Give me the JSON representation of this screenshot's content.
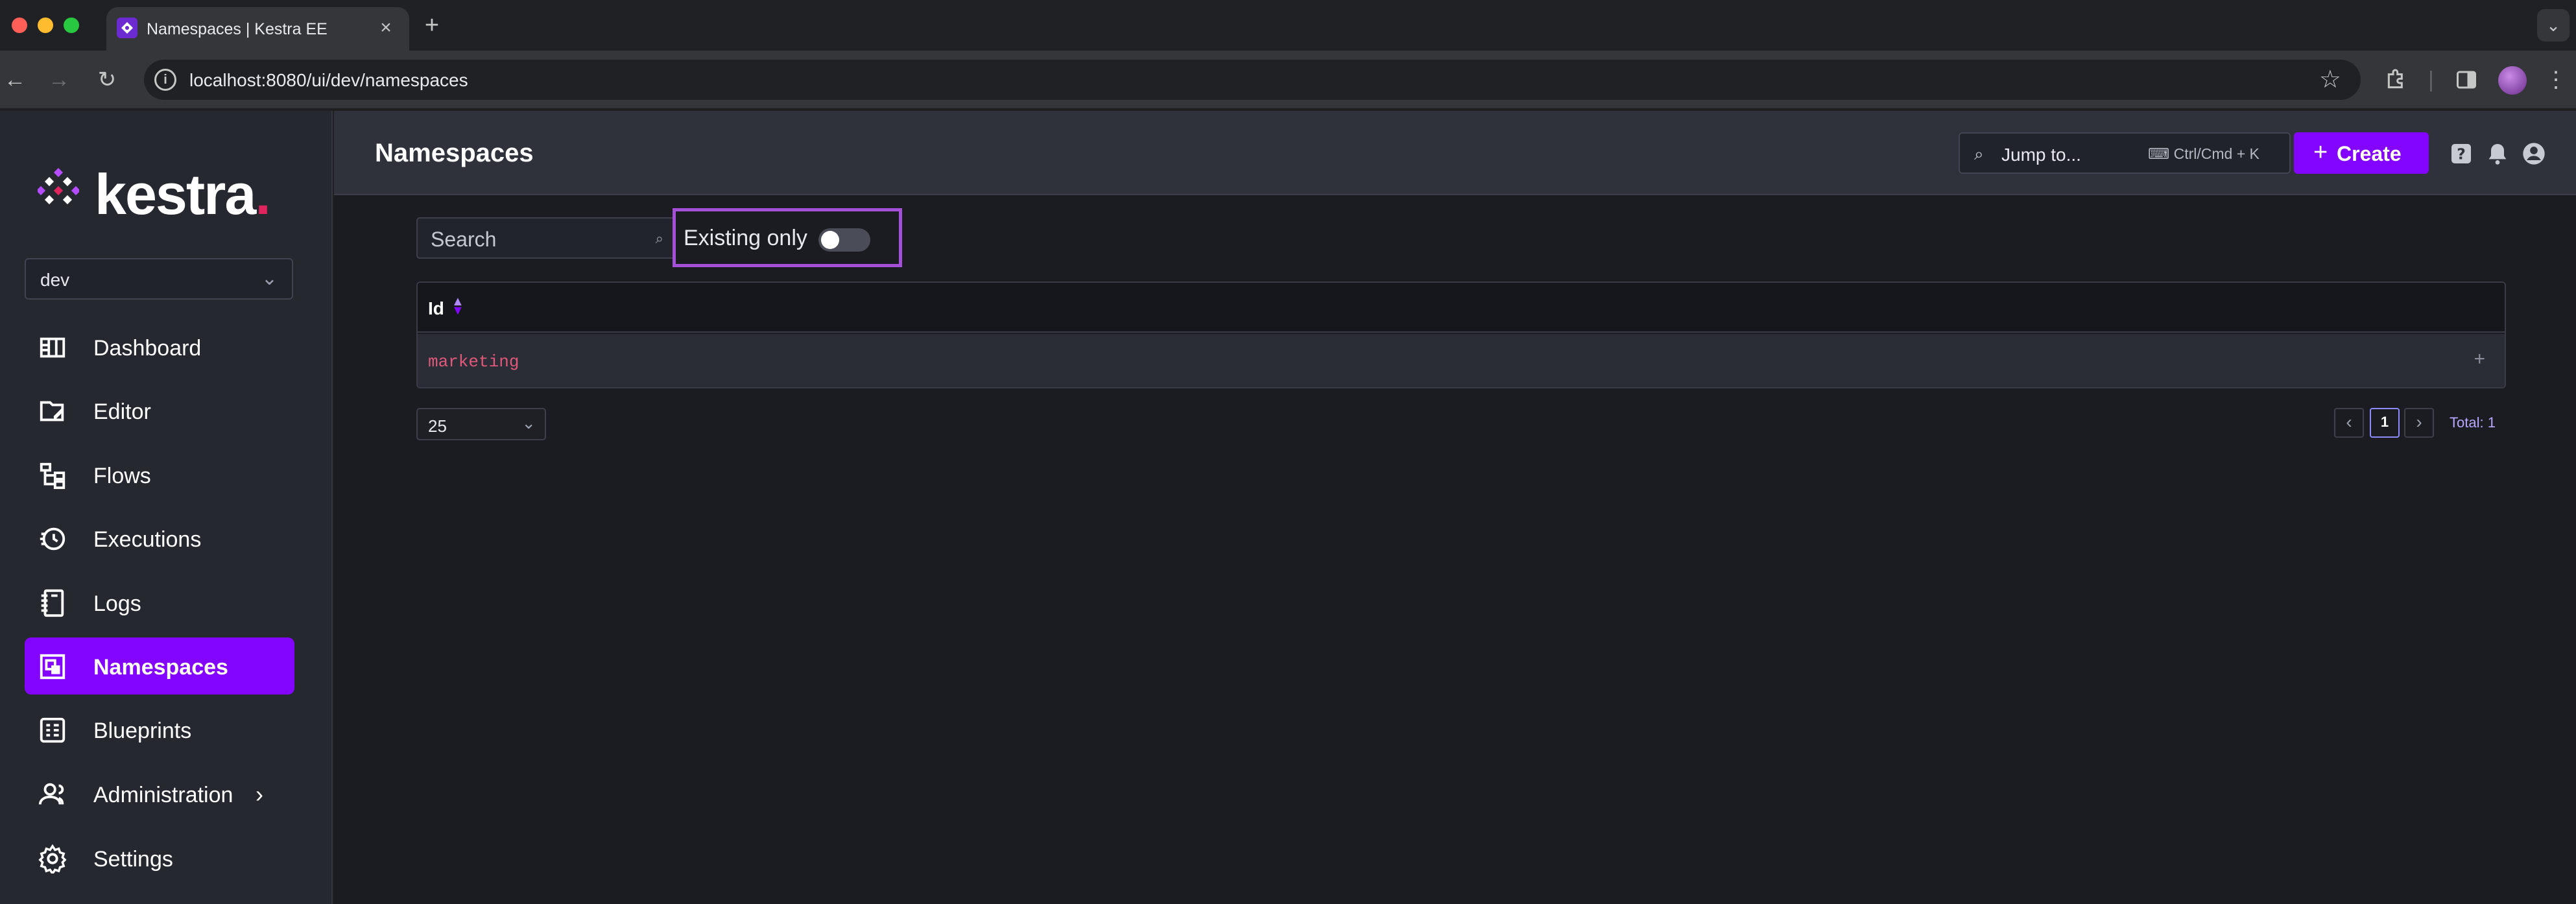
{
  "browser": {
    "tab_title": "Namespaces | Kestra EE",
    "tab_close": "×",
    "new_tab": "+",
    "url": "localhost:8080/ui/dev/namespaces"
  },
  "sidebar": {
    "brand": "kestra",
    "brand_dot": ".",
    "tenant": "dev",
    "items": [
      {
        "label": "Dashboard",
        "icon": "dashboard-icon"
      },
      {
        "label": "Editor",
        "icon": "editor-icon"
      },
      {
        "label": "Flows",
        "icon": "flows-icon"
      },
      {
        "label": "Executions",
        "icon": "executions-icon"
      },
      {
        "label": "Logs",
        "icon": "logs-icon"
      },
      {
        "label": "Namespaces",
        "icon": "namespaces-icon",
        "active": true
      },
      {
        "label": "Blueprints",
        "icon": "blueprints-icon"
      },
      {
        "label": "Administration",
        "icon": "administration-icon"
      },
      {
        "label": "Settings",
        "icon": "settings-icon"
      }
    ]
  },
  "header": {
    "title": "Namespaces",
    "jump_label": "Jump to...",
    "jump_shortcut": "Ctrl/Cmd + K",
    "create_label": "Create"
  },
  "filters": {
    "search_placeholder": "Search",
    "existing_only_label": "Existing only",
    "existing_only_on": false
  },
  "table": {
    "columns": [
      "Id"
    ],
    "rows": [
      {
        "id": "marketing"
      }
    ]
  },
  "pagination": {
    "page_size": "25",
    "current_page": "1",
    "total": "Total: 1"
  },
  "colors": {
    "accent": "#8405ff",
    "highlight_box": "#a450d8",
    "namespace_text": "#e0587a"
  }
}
